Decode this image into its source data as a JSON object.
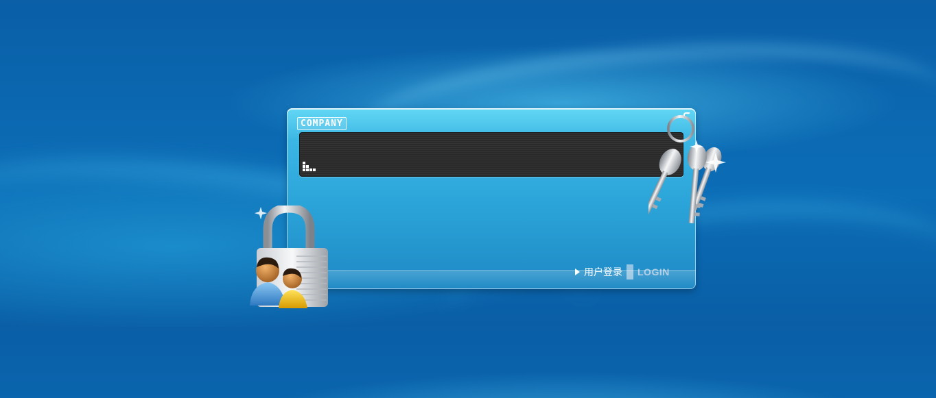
{
  "panel": {
    "brand": "COMPANY",
    "login": {
      "label_cn": "用户登录",
      "label_en": "LOGIN"
    }
  },
  "icons": {
    "lock": "padlock-with-users-icon",
    "keys": "keys-icon",
    "arrow": "play-arrow-icon",
    "corner": "corner-arrow-icon",
    "display": "pixel-dots-icon"
  },
  "colors": {
    "background": "#0b68b1",
    "panel": "#2aa3d8",
    "display": "#2a2a2a",
    "login_en": "#a9c8e2"
  }
}
